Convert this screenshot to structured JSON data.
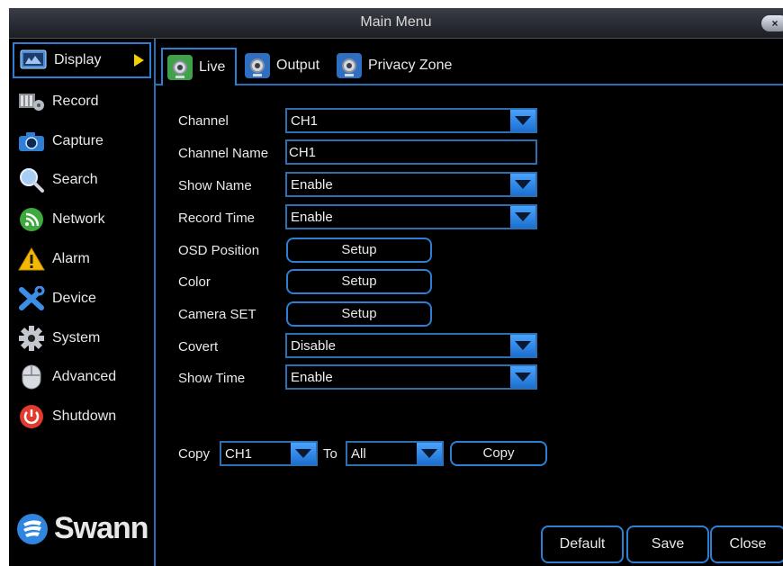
{
  "window": {
    "title": "Main Menu",
    "close_glyph": "×"
  },
  "sidebar": {
    "items": [
      {
        "label": "Display",
        "icon": "display-icon"
      },
      {
        "label": "Record",
        "icon": "record-icon"
      },
      {
        "label": "Capture",
        "icon": "camera-icon"
      },
      {
        "label": "Search",
        "icon": "search-icon"
      },
      {
        "label": "Network",
        "icon": "network-icon"
      },
      {
        "label": "Alarm",
        "icon": "alarm-icon"
      },
      {
        "label": "Device",
        "icon": "device-icon"
      },
      {
        "label": "System",
        "icon": "gear-icon"
      },
      {
        "label": "Advanced",
        "icon": "mouse-icon"
      },
      {
        "label": "Shutdown",
        "icon": "power-icon"
      }
    ],
    "active_index": 0,
    "logo_text": "Swann"
  },
  "tabs": [
    {
      "label": "Live",
      "icon": "live-icon"
    },
    {
      "label": "Output",
      "icon": "output-icon"
    },
    {
      "label": "Privacy Zone",
      "icon": "privacy-zone-icon"
    }
  ],
  "form": {
    "channel": {
      "label": "Channel",
      "value": "CH1"
    },
    "channel_name": {
      "label": "Channel Name",
      "value": "CH1"
    },
    "show_name": {
      "label": "Show Name",
      "value": "Enable"
    },
    "record_time": {
      "label": "Record Time",
      "value": "Enable"
    },
    "osd_position": {
      "label": "OSD Position",
      "button": "Setup"
    },
    "color": {
      "label": "Color",
      "button": "Setup"
    },
    "camera_set": {
      "label": "Camera SET",
      "button": "Setup"
    },
    "covert": {
      "label": "Covert",
      "value": "Disable"
    },
    "show_time": {
      "label": "Show Time",
      "value": "Enable"
    }
  },
  "copy": {
    "label": "Copy",
    "from_value": "CH1",
    "to_label": "To",
    "to_value": "All",
    "button": "Copy"
  },
  "footer": {
    "default": "Default",
    "save": "Save",
    "close": "Close"
  },
  "colors": {
    "accent": "#2d7fd3",
    "arrow": "#f4d000",
    "background": "#000000"
  }
}
